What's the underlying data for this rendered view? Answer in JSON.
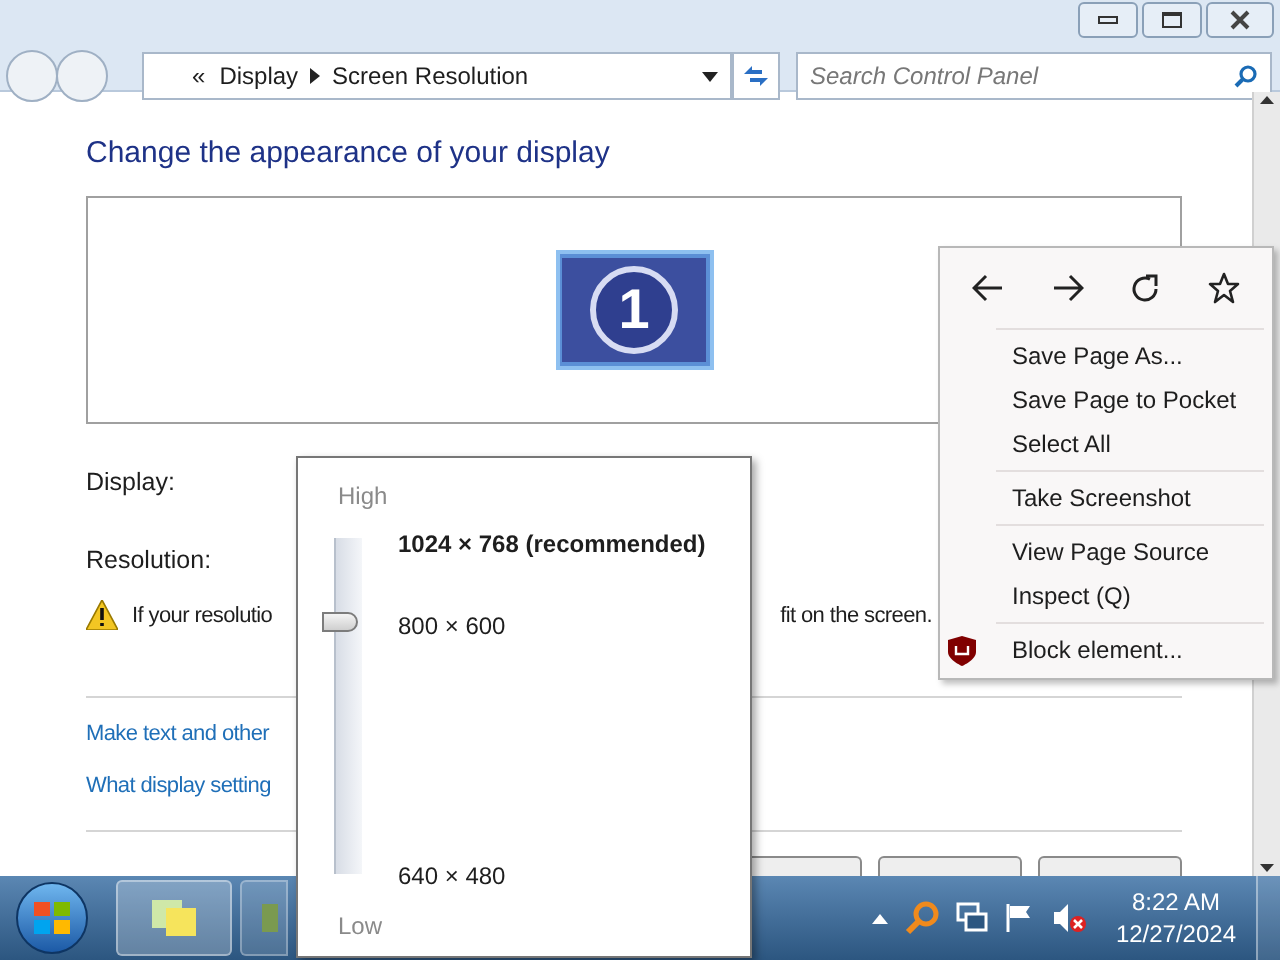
{
  "address_bar": {
    "overflow": "«",
    "breadcrumbs": [
      "Display",
      "Screen Resolution"
    ]
  },
  "search": {
    "placeholder": "Search Control Panel"
  },
  "heading": "Change the appearance of your display",
  "monitor": {
    "label": "1"
  },
  "fields": [
    {
      "label": "Display:"
    },
    {
      "label": "Resolution:"
    }
  ],
  "warning": {
    "text_parts": [
      "If your resolutio",
      "fit on the screen."
    ]
  },
  "links": [
    "Make text and other",
    "What display setting"
  ],
  "resolution_popup": {
    "high_label": "High",
    "low_label": "Low",
    "level": 0.75,
    "options": [
      {
        "label": "1024 × 768 (recommended)",
        "kind": "recommended"
      },
      {
        "label": "800 × 600",
        "kind": "normal"
      },
      {
        "label": "640 × 480",
        "kind": "normal"
      }
    ]
  },
  "context_menu": {
    "groups": [
      [
        {
          "label": "Save Page As...",
          "kind": "plain"
        },
        {
          "label": "Save Page to Pocket",
          "kind": "plain"
        },
        {
          "label": "Select All",
          "kind": "plain"
        }
      ],
      [
        {
          "label": "Take Screenshot",
          "kind": "plain"
        }
      ],
      [
        {
          "label": "View Page Source",
          "kind": "plain"
        },
        {
          "label": "Inspect (Q)",
          "kind": "plain"
        }
      ],
      [
        {
          "label": "Block element...",
          "kind": "extension"
        }
      ]
    ]
  },
  "taskbar": {
    "time": "8:22 AM",
    "date": "12/27/2024"
  }
}
